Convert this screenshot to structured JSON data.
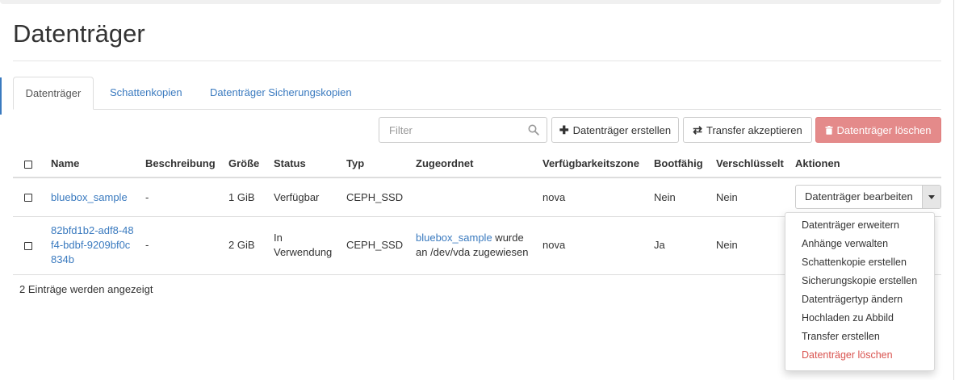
{
  "page": {
    "title": "Datenträger"
  },
  "tabs": [
    {
      "label": "Datenträger",
      "active": true
    },
    {
      "label": "Schattenkopien",
      "active": false
    },
    {
      "label": "Datenträger Sicherungskopien",
      "active": false
    }
  ],
  "toolbar": {
    "filter_placeholder": "Filter",
    "create_label": "Datenträger erstellen",
    "transfer_label": "Transfer akzeptieren",
    "delete_label": "Datenträger löschen",
    "delete_color": "#e48a8a"
  },
  "table": {
    "columns": [
      "Name",
      "Beschreibung",
      "Größe",
      "Status",
      "Typ",
      "Zugeordnet",
      "Verfügbarkeitszone",
      "Bootfähig",
      "Verschlüsselt",
      "Aktionen"
    ],
    "rows": [
      {
        "name": "bluebox_sample",
        "description": "-",
        "size": "1 GiB",
        "status": "Verfügbar",
        "type": "CEPH_SSD",
        "attached_link": "",
        "attached_text": "",
        "zone": "nova",
        "bootable": "Nein",
        "encrypted": "Nein",
        "action": "Datenträger bearbeiten"
      },
      {
        "name": "82bfd1b2-adf8-48f4-bdbf-9209bf0c834b",
        "name_lines": [
          "82bfd1b2-adf8-48",
          "f4-bdbf-9209bf0c",
          "834b"
        ],
        "description": "-",
        "size": "2 GiB",
        "status_lines": [
          "In",
          "Verwendung"
        ],
        "type": "CEPH_SSD",
        "attached_link": "bluebox_sample",
        "attached_text_1": " wurde",
        "attached_text_2": "an /dev/vda zugewiesen",
        "zone": "nova",
        "bootable": "Ja",
        "encrypted": "Nein"
      }
    ]
  },
  "footer": {
    "count_text": "2 Einträge werden angezeigt"
  },
  "action_menu": {
    "items": [
      "Datenträger erweitern",
      "Anhänge verwalten",
      "Schattenkopie erstellen",
      "Sicherungskopie erstellen",
      "Datenträgertyp ändern",
      "Hochladen zu Abbild",
      "Transfer erstellen"
    ],
    "danger_item": "Datenträger löschen",
    "danger_color": "#d9534f"
  },
  "colors": {
    "link": "#3a7abf",
    "border": "#dddddd"
  },
  "icons": {
    "filter": "search-icon",
    "create": "plus-icon",
    "transfer": "exchange-icon",
    "delete": "trash-icon",
    "dropdown": "caret-down-icon"
  }
}
